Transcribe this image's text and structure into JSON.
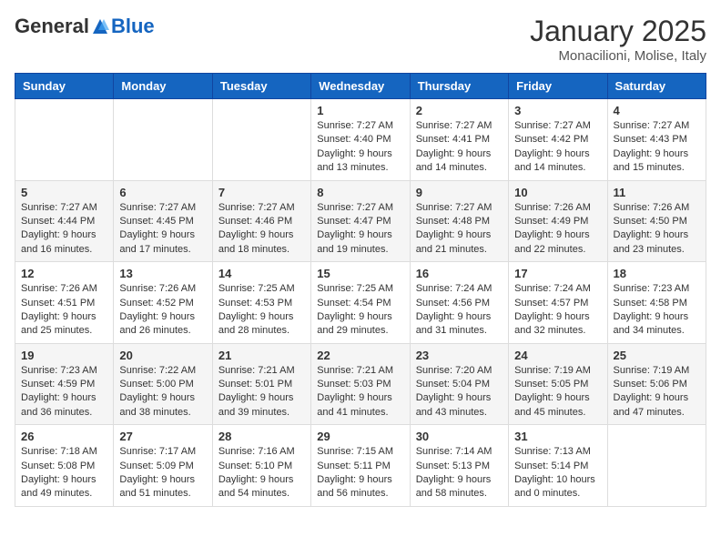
{
  "header": {
    "logo_general": "General",
    "logo_blue": "Blue",
    "month": "January 2025",
    "location": "Monacilioni, Molise, Italy"
  },
  "days_of_week": [
    "Sunday",
    "Monday",
    "Tuesday",
    "Wednesday",
    "Thursday",
    "Friday",
    "Saturday"
  ],
  "weeks": [
    [
      {
        "day": "",
        "info": ""
      },
      {
        "day": "",
        "info": ""
      },
      {
        "day": "",
        "info": ""
      },
      {
        "day": "1",
        "info": "Sunrise: 7:27 AM\nSunset: 4:40 PM\nDaylight: 9 hours and 13 minutes."
      },
      {
        "day": "2",
        "info": "Sunrise: 7:27 AM\nSunset: 4:41 PM\nDaylight: 9 hours and 14 minutes."
      },
      {
        "day": "3",
        "info": "Sunrise: 7:27 AM\nSunset: 4:42 PM\nDaylight: 9 hours and 14 minutes."
      },
      {
        "day": "4",
        "info": "Sunrise: 7:27 AM\nSunset: 4:43 PM\nDaylight: 9 hours and 15 minutes."
      }
    ],
    [
      {
        "day": "5",
        "info": "Sunrise: 7:27 AM\nSunset: 4:44 PM\nDaylight: 9 hours and 16 minutes."
      },
      {
        "day": "6",
        "info": "Sunrise: 7:27 AM\nSunset: 4:45 PM\nDaylight: 9 hours and 17 minutes."
      },
      {
        "day": "7",
        "info": "Sunrise: 7:27 AM\nSunset: 4:46 PM\nDaylight: 9 hours and 18 minutes."
      },
      {
        "day": "8",
        "info": "Sunrise: 7:27 AM\nSunset: 4:47 PM\nDaylight: 9 hours and 19 minutes."
      },
      {
        "day": "9",
        "info": "Sunrise: 7:27 AM\nSunset: 4:48 PM\nDaylight: 9 hours and 21 minutes."
      },
      {
        "day": "10",
        "info": "Sunrise: 7:26 AM\nSunset: 4:49 PM\nDaylight: 9 hours and 22 minutes."
      },
      {
        "day": "11",
        "info": "Sunrise: 7:26 AM\nSunset: 4:50 PM\nDaylight: 9 hours and 23 minutes."
      }
    ],
    [
      {
        "day": "12",
        "info": "Sunrise: 7:26 AM\nSunset: 4:51 PM\nDaylight: 9 hours and 25 minutes."
      },
      {
        "day": "13",
        "info": "Sunrise: 7:26 AM\nSunset: 4:52 PM\nDaylight: 9 hours and 26 minutes."
      },
      {
        "day": "14",
        "info": "Sunrise: 7:25 AM\nSunset: 4:53 PM\nDaylight: 9 hours and 28 minutes."
      },
      {
        "day": "15",
        "info": "Sunrise: 7:25 AM\nSunset: 4:54 PM\nDaylight: 9 hours and 29 minutes."
      },
      {
        "day": "16",
        "info": "Sunrise: 7:24 AM\nSunset: 4:56 PM\nDaylight: 9 hours and 31 minutes."
      },
      {
        "day": "17",
        "info": "Sunrise: 7:24 AM\nSunset: 4:57 PM\nDaylight: 9 hours and 32 minutes."
      },
      {
        "day": "18",
        "info": "Sunrise: 7:23 AM\nSunset: 4:58 PM\nDaylight: 9 hours and 34 minutes."
      }
    ],
    [
      {
        "day": "19",
        "info": "Sunrise: 7:23 AM\nSunset: 4:59 PM\nDaylight: 9 hours and 36 minutes."
      },
      {
        "day": "20",
        "info": "Sunrise: 7:22 AM\nSunset: 5:00 PM\nDaylight: 9 hours and 38 minutes."
      },
      {
        "day": "21",
        "info": "Sunrise: 7:21 AM\nSunset: 5:01 PM\nDaylight: 9 hours and 39 minutes."
      },
      {
        "day": "22",
        "info": "Sunrise: 7:21 AM\nSunset: 5:03 PM\nDaylight: 9 hours and 41 minutes."
      },
      {
        "day": "23",
        "info": "Sunrise: 7:20 AM\nSunset: 5:04 PM\nDaylight: 9 hours and 43 minutes."
      },
      {
        "day": "24",
        "info": "Sunrise: 7:19 AM\nSunset: 5:05 PM\nDaylight: 9 hours and 45 minutes."
      },
      {
        "day": "25",
        "info": "Sunrise: 7:19 AM\nSunset: 5:06 PM\nDaylight: 9 hours and 47 minutes."
      }
    ],
    [
      {
        "day": "26",
        "info": "Sunrise: 7:18 AM\nSunset: 5:08 PM\nDaylight: 9 hours and 49 minutes."
      },
      {
        "day": "27",
        "info": "Sunrise: 7:17 AM\nSunset: 5:09 PM\nDaylight: 9 hours and 51 minutes."
      },
      {
        "day": "28",
        "info": "Sunrise: 7:16 AM\nSunset: 5:10 PM\nDaylight: 9 hours and 54 minutes."
      },
      {
        "day": "29",
        "info": "Sunrise: 7:15 AM\nSunset: 5:11 PM\nDaylight: 9 hours and 56 minutes."
      },
      {
        "day": "30",
        "info": "Sunrise: 7:14 AM\nSunset: 5:13 PM\nDaylight: 9 hours and 58 minutes."
      },
      {
        "day": "31",
        "info": "Sunrise: 7:13 AM\nSunset: 5:14 PM\nDaylight: 10 hours and 0 minutes."
      },
      {
        "day": "",
        "info": ""
      }
    ]
  ]
}
